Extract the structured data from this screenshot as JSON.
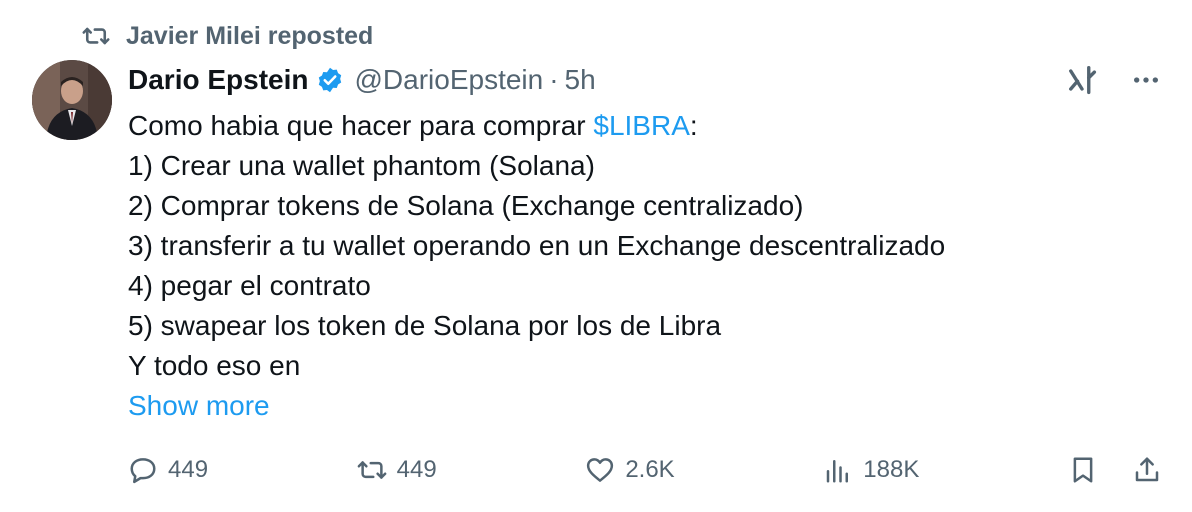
{
  "repost": {
    "label": "Javier Milei reposted"
  },
  "author": {
    "display_name": "Dario Epstein",
    "handle": "@DarioEpstein",
    "separator": "·",
    "time": "5h"
  },
  "body": {
    "intro_before": "Como habia que hacer para comprar ",
    "cashtag": "$LIBRA",
    "intro_after": ":",
    "steps": [
      "1) Crear una wallet phantom (Solana)",
      "2) Comprar tokens de Solana (Exchange centralizado)",
      "3) transferir a tu wallet operando en un Exchange descentralizado",
      "4) pegar el contrato",
      "5) swapear los token de Solana por los de Libra"
    ],
    "trailing": "Y todo eso en",
    "show_more": "Show more"
  },
  "actions": {
    "replies": "449",
    "reposts": "449",
    "likes": "2.6K",
    "views": "188K"
  },
  "colors": {
    "accent": "#1d9bf0",
    "muted": "#536471",
    "text": "#0f1419"
  },
  "icons": {
    "repost": "repost-icon",
    "verified": "verified-badge-icon",
    "grok": "grok-icon",
    "more": "more-icon",
    "reply": "reply-icon",
    "like": "like-icon",
    "views": "views-icon",
    "bookmark": "bookmark-icon",
    "share": "share-icon"
  }
}
